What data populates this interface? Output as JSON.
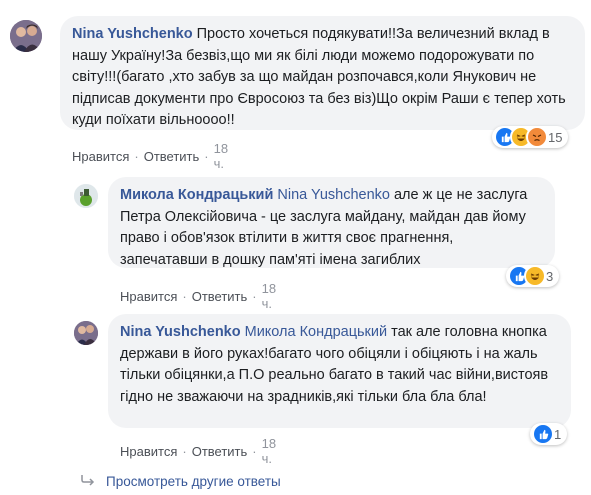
{
  "comments": [
    {
      "author": "Nina Yushchenko",
      "mention": "",
      "text": "Просто хочеться подякувати!!За величезний вклад в нашу Україну!За безвіз,що ми як білі люди можемо подорожувати по світу!!!(багато ,хто забув за що майдан розпочався,коли Янукович не підписав документи про Євросоюз та без віз)Що окрім Раши є тепер хоть куди поїхати вільноооо!!",
      "like": "Нравится",
      "reply": "Ответить",
      "time": "18 ч.",
      "reaction_count": "15"
    },
    {
      "author": "Микола Кондрацький",
      "mention": "Nina Yushchenko",
      "text": "але ж це не заслуга Петра Олексійовича - це заслуга майдану, майдан дав йому право і обов'язок втілити в життя своє прагнення, запечатавши в дошку пам'яті імена загиблих",
      "like": "Нравится",
      "reply": "Ответить",
      "time": "18 ч.",
      "reaction_count": "3"
    },
    {
      "author": "Nina Yushchenko",
      "mention": "Микола Кондрацький",
      "text": "так але головна кнопка держави в його руках!багато чого обіцяли і обіцяють і на жаль тільки обіцянки,а П.О реально багато в такий час війни,вистояв гідно не зважаючи на зрадників,які тільки бла бла бла!",
      "like": "Нравится",
      "reply": "Ответить",
      "time": "18 ч.",
      "reaction_count": "1"
    }
  ],
  "view_more": "Просмотреть другие ответы",
  "colors": {
    "link": "#385898",
    "bubble": "#f2f3f5",
    "like_blue": "#1877f2",
    "love_red": "#f33e58",
    "haha_yellow": "#f7b928"
  },
  "icons": [
    "avatar",
    "like-reaction-icon",
    "haha-reaction-icon",
    "angry-reaction-icon",
    "reply-arrow-icon"
  ]
}
